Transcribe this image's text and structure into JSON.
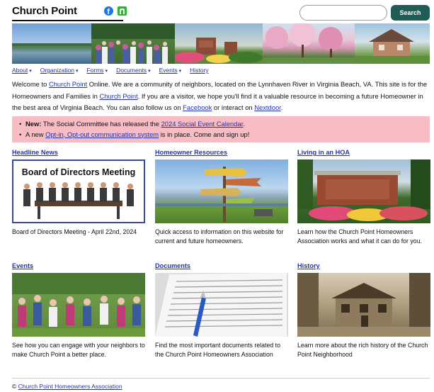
{
  "header": {
    "site_title": "Church Point",
    "search_placeholder": "",
    "search_button": "Search"
  },
  "nav": [
    {
      "label": "About"
    },
    {
      "label": "Organization"
    },
    {
      "label": "Forms"
    },
    {
      "label": "Documents"
    },
    {
      "label": "Events"
    },
    {
      "label": "History"
    }
  ],
  "intro": {
    "p1": "Welcome to ",
    "link_cp": "Church Point",
    "p2": " Online. We are a community of neighbors, located on the Lynnhaven River in Virginia Beach, VA. This site is for the Homeowners and Families in ",
    "link_cp2": "Church Point",
    "p3": ". If you are a visitor, we hope you'll find it a valuable resource in becoming a future Homeowner in the best area of Virginia Beach. You can also follow us on ",
    "link_fb": "Facebook",
    "p4": " or interact on ",
    "link_nd": "Nextdoor",
    "p5": "."
  },
  "notice": {
    "new_label": "New:",
    "line1_text": " The Social Committee has released the ",
    "line1_link": "2024 Social Event Calendar",
    "line1_end": ".",
    "line2_text": "A new ",
    "line2_link": "Opt-in, Opt-out communication system",
    "line2_end": " is in place. Come and sign up!"
  },
  "cards": [
    {
      "title": "Headline News",
      "text": "Board of Directors Meeting - April 22nd, 2024",
      "img_caption": "Board of Directors Meeting"
    },
    {
      "title": "Homeowner Resources",
      "text": "Quick access to information on this website for current and future homeowners."
    },
    {
      "title": "Living in an HOA",
      "text": "Learn how the Church Point Homeowners Association works and what it can do for you."
    },
    {
      "title": "Events",
      "text": "See how you can engage with your neighbors to make Church Point a better place."
    },
    {
      "title": "Documents",
      "text": "Find the most important documents related to the Church Point Homeowners Association"
    },
    {
      "title": "History",
      "text": "Learn more about the rich history of the Church Point Neighborhood"
    }
  ],
  "footer": {
    "copyright_symbol": "©",
    "link": "Church Point Homeowners Association"
  }
}
